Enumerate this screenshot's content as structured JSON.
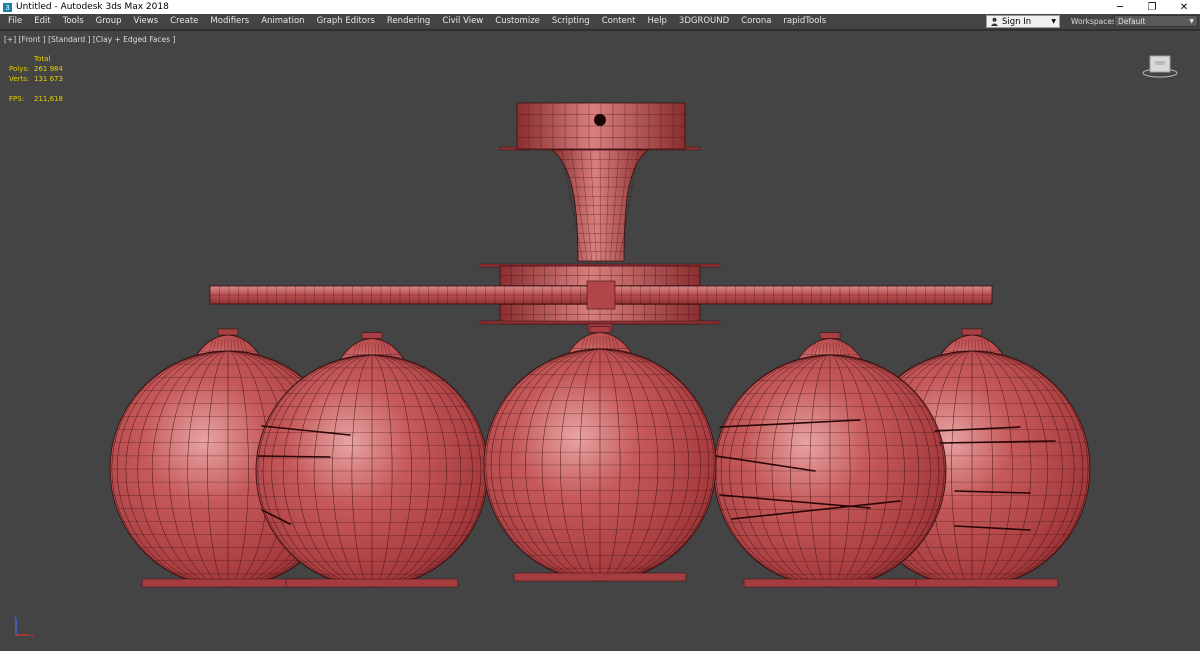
{
  "window": {
    "title": "Untitled - Autodesk 3ds Max 2018",
    "minimize": "─",
    "restore": "❐",
    "close": "✕"
  },
  "menu": [
    "File",
    "Edit",
    "Tools",
    "Group",
    "Views",
    "Create",
    "Modifiers",
    "Animation",
    "Graph Editors",
    "Rendering",
    "Civil View",
    "Customize",
    "Scripting",
    "Content",
    "Help",
    "3DGROUND",
    "Corona",
    "rapidTools"
  ],
  "account": {
    "signin_label": "Sign In"
  },
  "workspaces": {
    "label": "Workspaces:",
    "value": "Default"
  },
  "viewport": {
    "label": "[+] [Front ] [Standard ] [Clay + Edged Faces ]",
    "stats": {
      "header": "Total",
      "polys_label": "Polys:",
      "polys_value": "261 984",
      "verts_label": "Verts:",
      "verts_value": "131 673",
      "fps_label": "FPS:",
      "fps_value": "211,618"
    }
  },
  "colors": {
    "viewport_bg": "#444444",
    "clay": "#b8484b",
    "wire": "#3a0f10",
    "stats_text": "#e8d000"
  },
  "icons": [
    "app-icon",
    "user-icon",
    "viewcube-icon",
    "axis-tripod-icon"
  ]
}
